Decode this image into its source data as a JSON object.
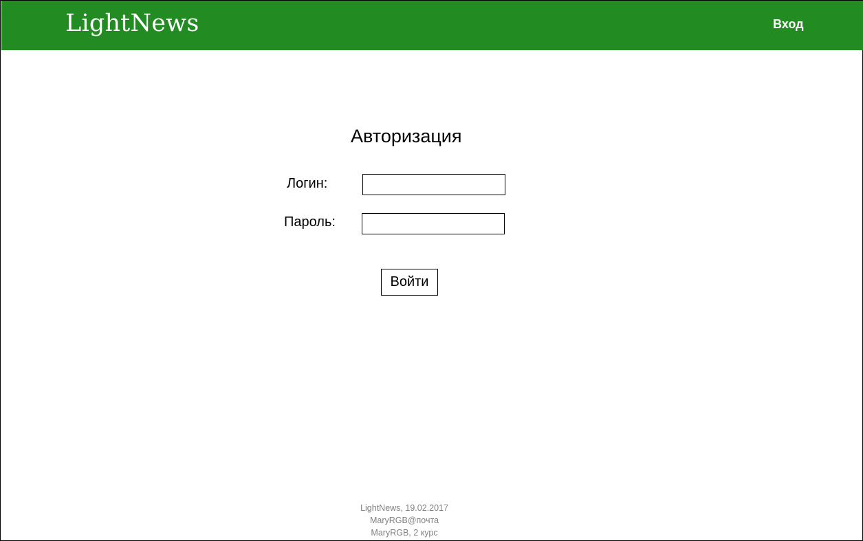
{
  "header": {
    "logo": "LightNews",
    "login_link": "Вход",
    "bg_color": "#228B22"
  },
  "auth": {
    "title": "Авторизация",
    "login_label": "Логин:",
    "login_value": "",
    "password_label": "Пароль:",
    "password_value": "",
    "submit_label": "Войти"
  },
  "footer": {
    "line1": "LightNews, 19.02.2017",
    "line2": "MaryRGB@почта",
    "line3": "MaryRGB, 2 курс"
  }
}
